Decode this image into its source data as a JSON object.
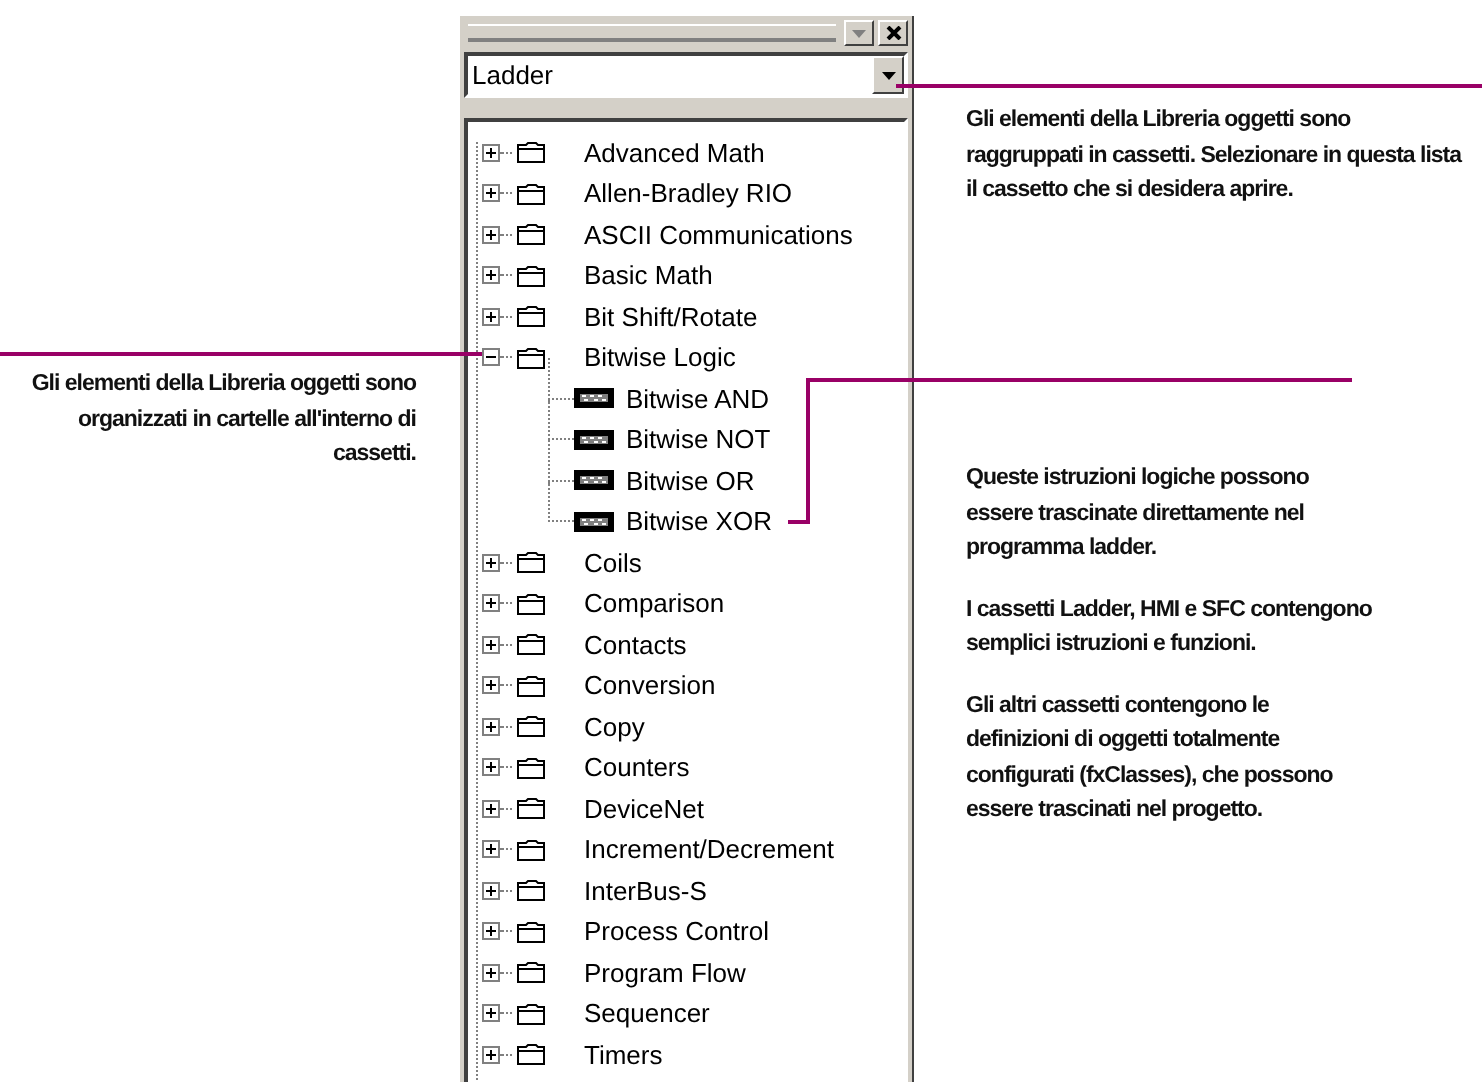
{
  "panel": {
    "drawer": "Ladder",
    "tree": [
      {
        "label": "Advanced Math",
        "expanded": false
      },
      {
        "label": "Allen-Bradley RIO",
        "expanded": false
      },
      {
        "label": "ASCII Communications",
        "expanded": false
      },
      {
        "label": "Basic Math",
        "expanded": false
      },
      {
        "label": "Bit Shift/Rotate",
        "expanded": false
      },
      {
        "label": "Bitwise Logic",
        "expanded": true,
        "children": [
          {
            "label": "Bitwise AND"
          },
          {
            "label": "Bitwise NOT"
          },
          {
            "label": "Bitwise OR"
          },
          {
            "label": "Bitwise XOR"
          }
        ]
      },
      {
        "label": "Coils",
        "expanded": false
      },
      {
        "label": "Comparison",
        "expanded": false
      },
      {
        "label": "Contacts",
        "expanded": false
      },
      {
        "label": "Conversion",
        "expanded": false
      },
      {
        "label": "Copy",
        "expanded": false
      },
      {
        "label": "Counters",
        "expanded": false
      },
      {
        "label": "DeviceNet",
        "expanded": false
      },
      {
        "label": "Increment/Decrement",
        "expanded": false
      },
      {
        "label": "InterBus-S",
        "expanded": false
      },
      {
        "label": "Process Control",
        "expanded": false
      },
      {
        "label": "Program Flow",
        "expanded": false
      },
      {
        "label": "Sequencer",
        "expanded": false
      },
      {
        "label": "Timers",
        "expanded": false
      }
    ]
  },
  "callouts": [
    {
      "kind": "drawer",
      "paragraphs": [
        "Gli elementi della Libreria oggetti sono raggruppati in cassetti. Selezionare in questa lista il cassetto che si desidera aprire."
      ]
    },
    {
      "kind": "folders",
      "paragraphs": [
        "Gli elementi della Libreria oggetti sono organizzati in cartelle all'interno di cassetti."
      ]
    },
    {
      "kind": "items",
      "paragraphs": [
        "Queste istruzioni logiche possono essere trascinate direttamente nel programma ladder.",
        "I cassetti Ladder, HMI e SFC contengono semplici istruzioni e funzioni.",
        "Gli altri cassetti contengono le definizioni di oggetti totalmente configurati (fxClasses), che possono essere trascinati nel progetto."
      ]
    }
  ]
}
